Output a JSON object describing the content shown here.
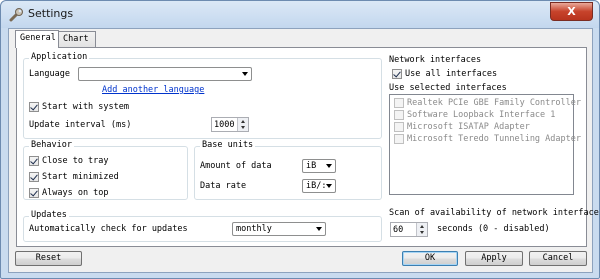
{
  "window": {
    "title": "Settings",
    "close_label": "X"
  },
  "tabs": [
    {
      "label": "General",
      "active": true
    },
    {
      "label": "Chart",
      "active": false
    }
  ],
  "application": {
    "title": "Application",
    "language_label": "Language",
    "language_value": "",
    "add_language_link": "Add another language",
    "start_with_system": {
      "label": "Start with system",
      "checked": true
    },
    "update_interval_label": "Update interval (ms)",
    "update_interval_value": "1000"
  },
  "behavior": {
    "title": "Behavior",
    "items": [
      {
        "label": "Close to tray",
        "checked": true
      },
      {
        "label": "Start minimized",
        "checked": true
      },
      {
        "label": "Always on top",
        "checked": true
      }
    ]
  },
  "base_units": {
    "title": "Base units",
    "amount_label": "Amount of data",
    "amount_value": "iB",
    "rate_label": "Data rate",
    "rate_value": "iB/:"
  },
  "updates": {
    "title": "Updates",
    "auto_check_label": "Automatically check for updates",
    "auto_check_value": "monthly"
  },
  "network": {
    "title": "Network interfaces",
    "use_all": {
      "label": "Use all interfaces",
      "checked": true
    },
    "use_selected_label": "Use selected interfaces",
    "interfaces": [
      {
        "label": "Realtek PCIe GBE Family Controller",
        "checked": false
      },
      {
        "label": "Software Loopback Interface 1",
        "checked": false
      },
      {
        "label": "Microsoft ISATAP Adapter",
        "checked": false
      },
      {
        "label": "Microsoft Teredo Tunneling Adapter",
        "checked": false
      }
    ],
    "scan_label": "Scan of availability of network interface:",
    "scan_value": "60",
    "scan_suffix": "seconds (0 - disabled)"
  },
  "buttons": {
    "reset": "Reset",
    "ok": "OK",
    "apply": "Apply",
    "cancel": "Cancel"
  }
}
